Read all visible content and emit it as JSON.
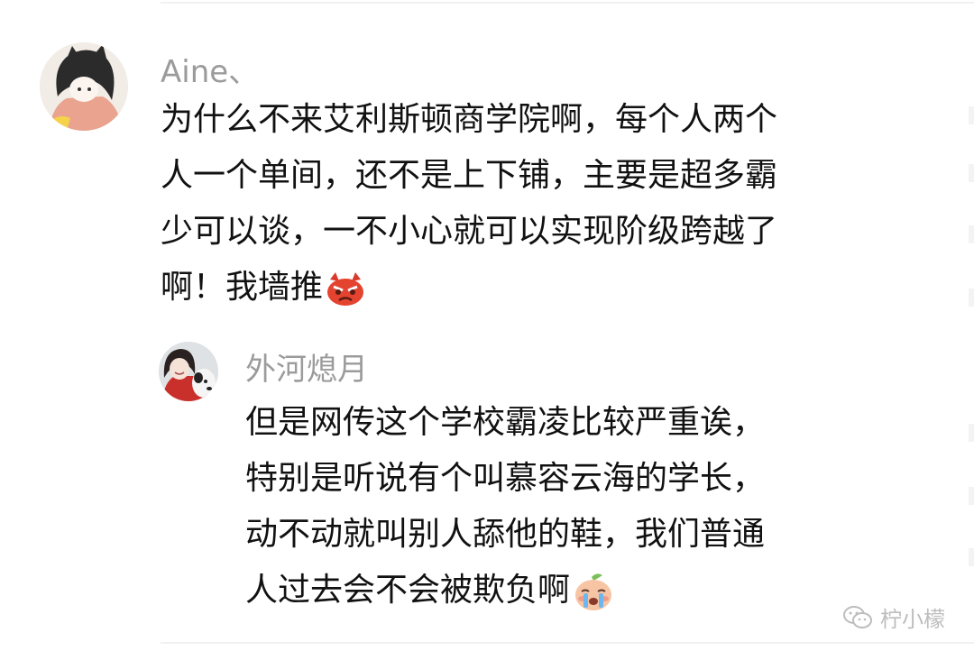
{
  "comment": {
    "username": "Aine、",
    "lines": [
      "为什么不来艾利斯顿商学院啊，每个人两个",
      "人一个单间，还不是上下铺，主要是超多霸",
      "少可以谈，一不小心就可以实现阶级跨越了",
      "啊！我墙推"
    ],
    "emoji_icon": "angry-devil-icon"
  },
  "reply": {
    "username": "外河熄月",
    "lines": [
      "但是网传这个学校霸凌比较严重诶，",
      "特别是听说有个叫慕容云海的学长，",
      "动不动就叫别人舔他的鞋，我们普通",
      "人过去会不会被欺负啊"
    ],
    "emoji_icon": "crying-peach-icon"
  },
  "watermark": {
    "text": "柠小檬",
    "icon": "wechat-icon"
  }
}
